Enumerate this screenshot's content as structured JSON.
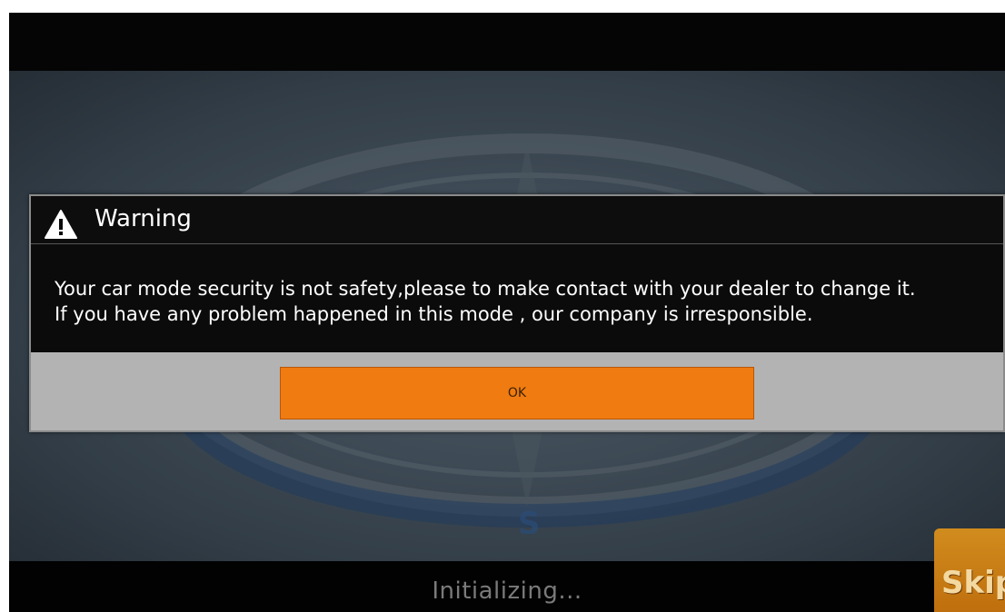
{
  "status_bar": {
    "text": "Initializing..."
  },
  "dialog": {
    "title": "Warning",
    "icon": "warning-icon",
    "message_lines": [
      "Your car mode security is not safety,please to make contact with your dealer to change it.",
      "If you have any problem happened in this mode , our company is irresponsible."
    ],
    "ok_label": "OK"
  },
  "skip_button": {
    "label": "Skip"
  },
  "splash": {
    "compass_letter_south": "S"
  },
  "colors": {
    "ok_button": "#f07b10",
    "skip_button": "#c97a14",
    "dialog_background": "#0b0b0b",
    "button_bar": "#b3b3b3"
  }
}
